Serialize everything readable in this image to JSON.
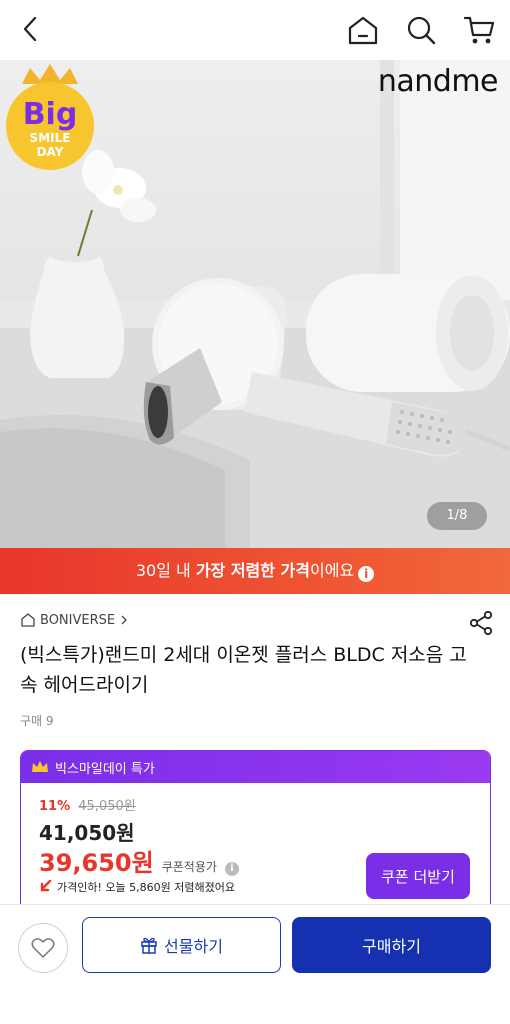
{
  "nav": {
    "icons": [
      "back-icon",
      "home-icon",
      "search-icon",
      "cart-icon"
    ]
  },
  "hero": {
    "brand_logo": "nandme",
    "counter": "1/8",
    "badge": {
      "line1": "Big",
      "line2": "SMILE",
      "line3": "DAY"
    }
  },
  "banner": {
    "prefix": "30일 내 ",
    "bold": "가장 저렴한 가격",
    "suffix": "이에요"
  },
  "product": {
    "brand": "BONIVERSE",
    "title": "(빅스특가)랜드미 2세대 이온젯 플러스 BLDC 저소음 고속 헤어드라이기",
    "sold": "구매 9"
  },
  "promo": {
    "header": "빅스마일데이 특가",
    "discount_pct": "11%",
    "original_price": "45,050원",
    "sale_price": "41,050원",
    "coupon_price": "39,650원",
    "coupon_label": "쿠폰적용가",
    "price_drop_text": "가격인하! 오늘 5,860원 저렴해졌어요",
    "coupon_button": "쿠폰 더받기"
  },
  "bottom": {
    "gift_label": "선물하기",
    "buy_label": "구매하기"
  },
  "colors": {
    "banner_red": "#e8362c",
    "promo_purple": "#7a2ee8",
    "buy_blue": "#1530b0",
    "price_red": "#e8362c"
  }
}
